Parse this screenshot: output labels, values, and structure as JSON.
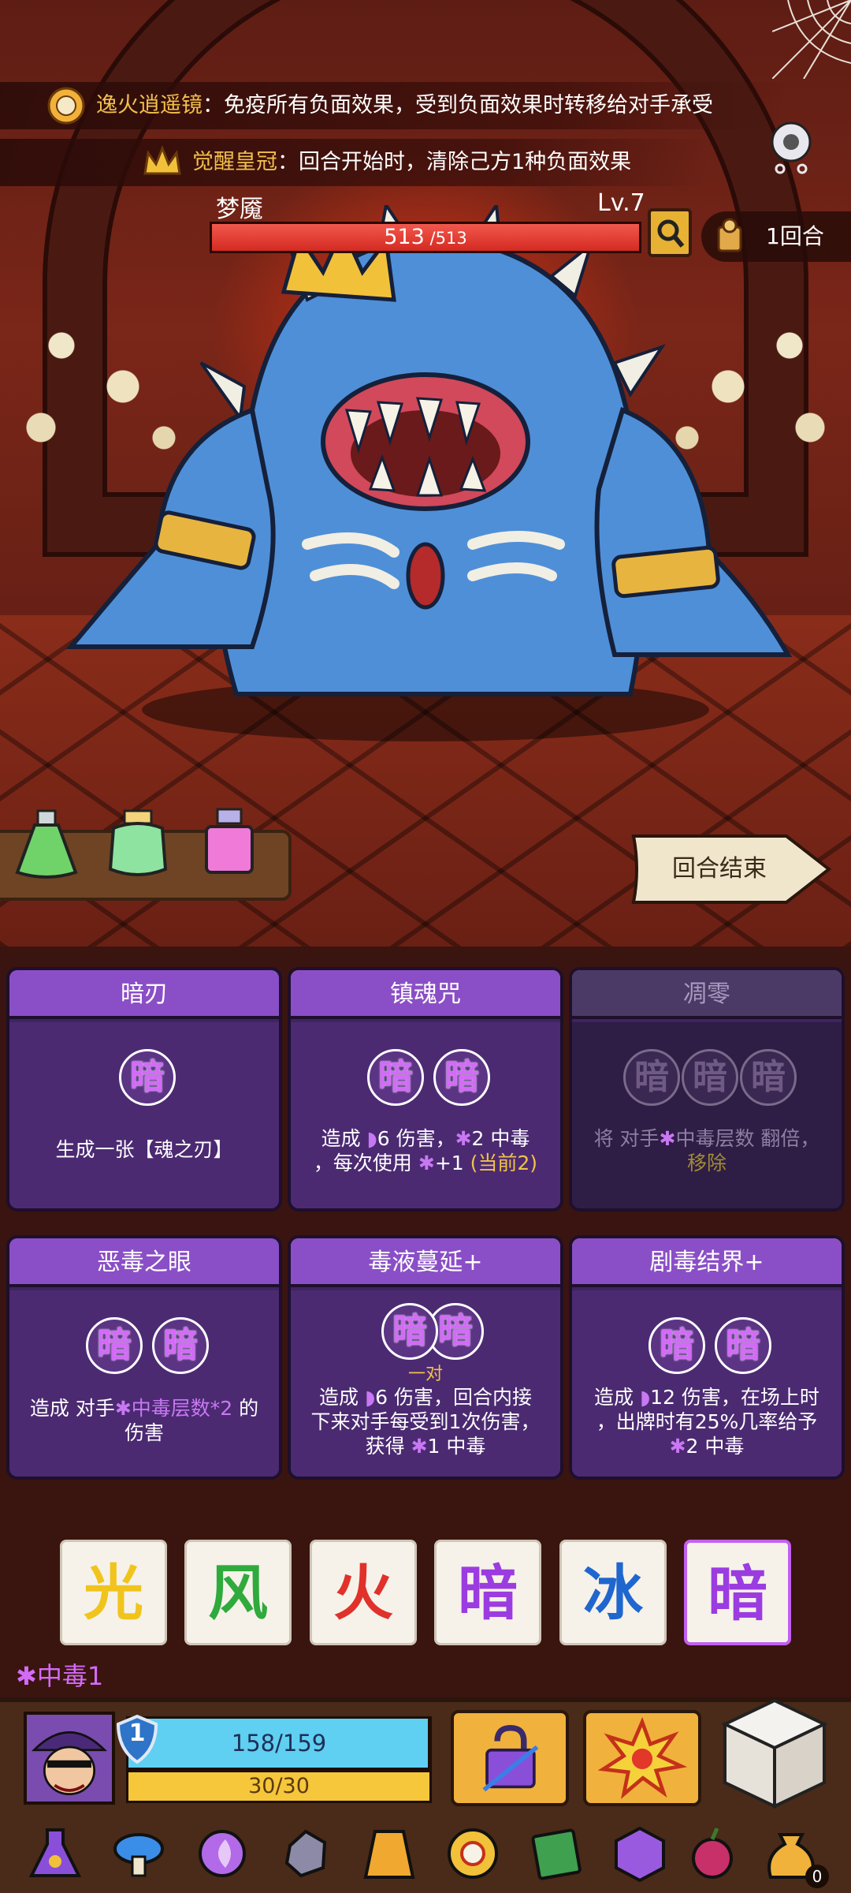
{
  "banners": [
    {
      "name": "逸火逍遥镜",
      "desc": "：免疫所有负面效果，受到负面效果时转移给对手承受"
    },
    {
      "name": "觉醒皇冠",
      "desc": "：回合开始时，清除己方1种负面效果"
    }
  ],
  "enemy": {
    "name": "梦魇",
    "level": "Lv.7",
    "hp": "513",
    "hp_sep": " /",
    "hp_max": "513",
    "hp_fraction": 1.0
  },
  "turn": {
    "label": "1回合"
  },
  "end_turn": {
    "label": "回合结束"
  },
  "cards": [
    {
      "title": "暗刃",
      "runes": [
        "暗"
      ],
      "desc_html": "生成一张【魂之刃】",
      "disabled": false
    },
    {
      "title": "镇魂咒",
      "runes": [
        "暗",
        "暗"
      ],
      "desc_html": "造成 <span class='moon'>◗</span>6 伤害，<span class='p'>✱</span>2 中毒<br>，每次使用 <span class='p'>✱</span>+1 <span class='y'>(当前2)</span>",
      "disabled": false
    },
    {
      "title": "凋零",
      "runes": [
        "暗",
        "暗",
        "暗"
      ],
      "desc_html": "将 对手<span class='p'>✱</span>中毒层数 翻倍，<br><span class='y'>移除</span>",
      "disabled": true
    },
    {
      "title": "恶毒之眼",
      "runes": [
        "暗",
        "暗"
      ],
      "desc_html": "造成 对手<span class='p'>✱中毒层数*2</span> 的<br>伤害",
      "disabled": false
    },
    {
      "title": "毒液蔓延+",
      "runes": [
        "暗",
        "暗"
      ],
      "pair_label": "一对",
      "desc_html": "造成 <span class='moon'>◗</span>6 伤害，回合内接<br>下来对手每受到1次伤害，<br>获得 <span class='p'>✱</span>1 中毒",
      "disabled": false
    },
    {
      "title": "剧毒结界+",
      "runes": [
        "暗",
        "暗"
      ],
      "desc_html": "造成 <span class='moon'>◗</span>12 伤害，在场上时<br>，出牌时有25%几率给予<br><span class='p'>✱</span>2 中毒",
      "disabled": false
    }
  ],
  "dice": [
    {
      "glyph": "光",
      "color": "#f0c41c",
      "selected": false
    },
    {
      "glyph": "风",
      "color": "#2faa3c",
      "selected": false
    },
    {
      "glyph": "火",
      "color": "#e0312a",
      "selected": false
    },
    {
      "glyph": "暗",
      "color": "#9b3ce0",
      "selected": false
    },
    {
      "glyph": "冰",
      "color": "#2066cf",
      "selected": false
    },
    {
      "glyph": "暗",
      "color": "#9b3ce0",
      "selected": true
    }
  ],
  "status": {
    "poison": "✱中毒1"
  },
  "player": {
    "shield": "1",
    "hp": "158/159",
    "hp_fraction": 0.994,
    "energy": "30/30",
    "energy_fraction": 1.0
  },
  "relic_count": "0",
  "colors": {
    "card_purple": "#8a4fc6",
    "poison": "#d36bf7",
    "gold": "#f1c14a",
    "enemy_hp": "#e2342a",
    "player_hp": "#5fcff2",
    "player_energy": "#f6c63b"
  },
  "icons": [
    "mirror-icon",
    "crown-icon",
    "settings-gear-icon",
    "inspect-icon",
    "turn-scroll-icon",
    "lock-skill-icon",
    "explosion-skill-icon",
    "dice-cube-icon"
  ]
}
